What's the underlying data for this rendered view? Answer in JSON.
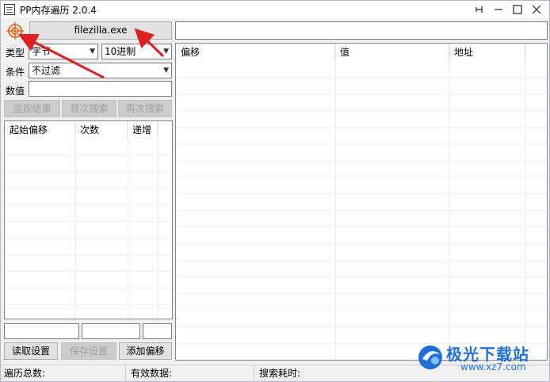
{
  "window": {
    "title": "PP内存遍历 2.0.4"
  },
  "toolbar": {
    "process_label": "filezilla.exe"
  },
  "form": {
    "type_label": "类型",
    "type_value": "字节",
    "radix_value": "10进制",
    "condition_label": "条件",
    "condition_value": "不过滤",
    "value_label": "数值",
    "value_text": ""
  },
  "buttons": {
    "monitor": "监视结果",
    "first_search": "首次搜索",
    "next_search": "再次搜索",
    "read_settings": "读取设置",
    "save_settings": "保存设置",
    "add_offset": "添加偏移"
  },
  "offset_table": {
    "columns": [
      "起始偏移",
      "次数",
      "递增"
    ]
  },
  "result_table": {
    "columns": [
      "偏移",
      "值",
      "地址"
    ]
  },
  "statusbar": {
    "total": "遍历总数:",
    "valid": "有效数据:",
    "time": "搜索耗时:"
  },
  "watermark": {
    "name": "极光下载站",
    "url": "www.xz7.com"
  },
  "colors": {
    "arrow": "#e02020",
    "watermark": "#1e6fd6",
    "target": "#e05a00"
  }
}
